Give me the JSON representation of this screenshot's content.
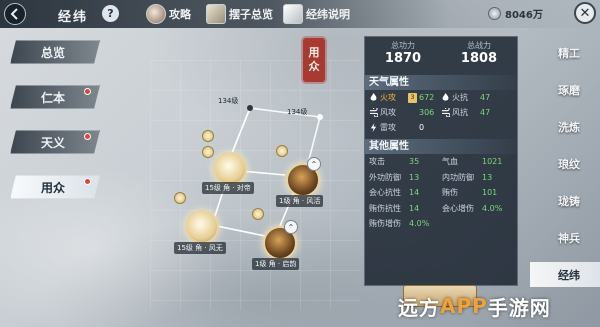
{
  "header": {
    "title": "经纬",
    "help": "?",
    "links": [
      {
        "label": "攻略",
        "icon": "avatar-icon"
      },
      {
        "label": "摆子总览",
        "icon": "scroll-icon"
      },
      {
        "label": "经纬说明",
        "icon": "dice-icon"
      }
    ],
    "currency": "8046万",
    "close": "✕"
  },
  "left_menu": {
    "items": [
      {
        "label": "总览",
        "active": false,
        "badge": false
      },
      {
        "label": "仁本",
        "active": false,
        "badge": true
      },
      {
        "label": "天义",
        "active": false,
        "badge": true
      },
      {
        "label": "用众",
        "active": true,
        "badge": true
      }
    ]
  },
  "seal": {
    "line1": "用",
    "line2": "众"
  },
  "graph": {
    "locks": [
      "134级",
      "134级"
    ],
    "nodes": [
      {
        "label": "15级 角 · 对帝"
      },
      {
        "label": "1级 角 · 风活"
      },
      {
        "label": "15级 角 · 风无"
      },
      {
        "label": "1级 角 · 启韵"
      }
    ]
  },
  "stats": {
    "total_power_label": "总功力",
    "total_power": "1870",
    "total_score_label": "总战力",
    "total_score": "1808",
    "weather_title": "天气属性",
    "weather": [
      [
        {
          "k": "火攻",
          "v": "672",
          "lvl": "3"
        },
        {
          "k": "火抗",
          "v": "47"
        }
      ],
      [
        {
          "k": "风攻",
          "v": "306"
        },
        {
          "k": "风抗",
          "v": "47"
        }
      ],
      [
        {
          "k": "雷攻",
          "v": "0"
        }
      ]
    ],
    "other_title": "其他属性",
    "other": [
      [
        {
          "k": "攻击",
          "v": "35"
        },
        {
          "k": "气血",
          "v": "1021"
        }
      ],
      [
        {
          "k": "外功防御",
          "v": "13"
        },
        {
          "k": "内功防御",
          "v": "13"
        }
      ],
      [
        {
          "k": "会心抗性",
          "v": "14"
        },
        {
          "k": "贿伤",
          "v": "101"
        }
      ],
      [
        {
          "k": "贿伤抗性",
          "v": "14"
        },
        {
          "k": "会心增伤",
          "v": "4.0%"
        }
      ],
      [
        {
          "k": "贿伤增伤",
          "v": "4.0%"
        }
      ]
    ]
  },
  "right_tabs": [
    {
      "label": "精工",
      "active": false
    },
    {
      "label": "琢磨",
      "active": false
    },
    {
      "label": "洗炼",
      "active": false
    },
    {
      "label": "琅纹",
      "active": false
    },
    {
      "label": "珑铸",
      "active": false
    },
    {
      "label": "神兵",
      "active": false
    },
    {
      "label": "经纬",
      "active": true
    }
  ],
  "watermark": {
    "part1": "远方",
    "part2": "APP",
    "part3": "手游网"
  },
  "colors": {
    "accent_red": "#e0433a",
    "stat_green": "#7ed67a",
    "seal_red": "#a93a32"
  }
}
